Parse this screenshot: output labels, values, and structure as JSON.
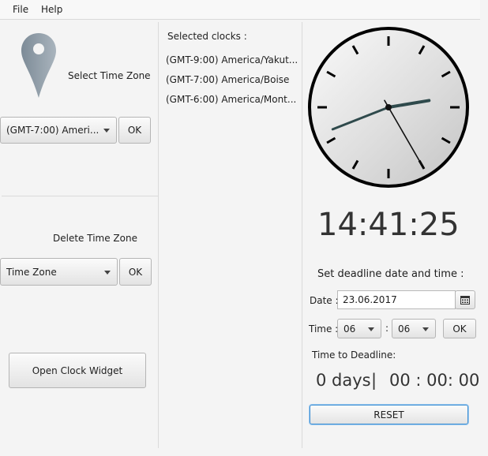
{
  "menu": {
    "file": "File",
    "help": "Help"
  },
  "left": {
    "select_tz_label": "Select Time Zone",
    "select_tz_value": "(GMT-7:00) Ameri...",
    "select_ok": "OK",
    "delete_tz_label": "Delete Time Zone",
    "delete_tz_value": "Time Zone",
    "delete_ok": "OK",
    "open_widget": "Open Clock Widget"
  },
  "middle": {
    "title": "Selected clocks :",
    "clocks": [
      "(GMT-9:00) America/Yakut...",
      "(GMT-7:00) America/Boise",
      "(GMT-6:00) America/Mont..."
    ]
  },
  "right": {
    "clock_time": {
      "hours": 14,
      "minutes": 41,
      "seconds": 25
    },
    "digital_time": "14:41:25",
    "deadline_title": "Set deadline date and time :",
    "date_label": "Date :",
    "date_value": "23.06.2017",
    "time_label": "Time :",
    "hour_value": "06",
    "colon": ":",
    "minute_value": "06",
    "time_ok": "OK",
    "ttd_label": "Time to Deadline:",
    "days": "0 days",
    "sep": "|",
    "countdown": "00 : 00: 00",
    "reset": "RESET"
  }
}
